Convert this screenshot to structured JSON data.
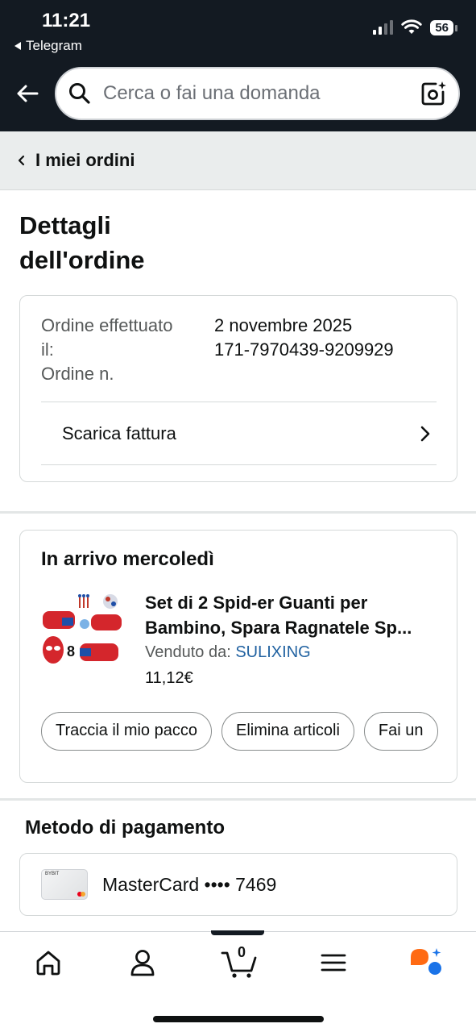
{
  "status_bar": {
    "time": "11:21",
    "back_app": "Telegram",
    "battery": "56"
  },
  "search": {
    "placeholder": "Cerca o fai una domanda"
  },
  "breadcrumb": {
    "label": "I miei ordini"
  },
  "page_title": "Dettagli dell'ordine",
  "order": {
    "placed_label": "Ordine effettuato il:",
    "number_label": "Ordine n.",
    "placed_value": "2 novembre 2025",
    "number_value": "171-7970439-9209929",
    "invoice_label": "Scarica fattura"
  },
  "shipment": {
    "title": "In arrivo mercoledì",
    "product_title": "Set di 2 Spid-er Guanti per Bambino, Spara Ragnatele Sp...",
    "sold_by_label": "Venduto da:",
    "seller": "SULIXING",
    "price": "11,12€",
    "actions": [
      "Traccia il mio pacco",
      "Elimina articoli",
      "Fai un"
    ]
  },
  "payment": {
    "title": "Metodo di pagamento",
    "card_brand_text": "BYBIT",
    "card_label": "MasterCard •••• 7469"
  },
  "bottom_nav": {
    "cart_count": "0",
    "items": [
      "home-icon",
      "account-icon",
      "cart-icon",
      "menu-icon",
      "assistant-icon"
    ]
  },
  "colors": {
    "header_bg": "#131a22",
    "link": "#2162a1",
    "crumb_bg": "#eaeded"
  }
}
